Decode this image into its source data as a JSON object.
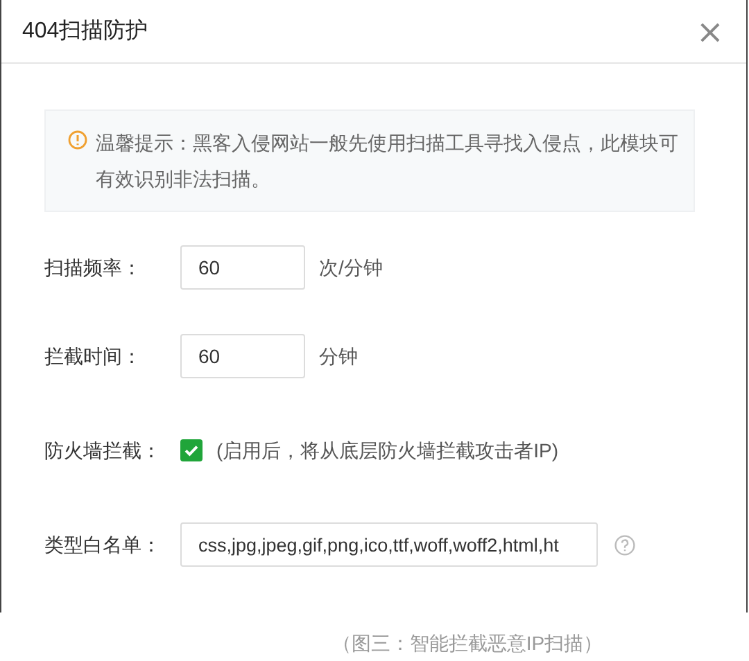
{
  "dialog": {
    "title": "404扫描防护",
    "close": "×"
  },
  "tip": "温馨提示：黑客入侵网站一般先使用扫描工具寻找入侵点，此模块可有效识别非法扫描。",
  "fields": [
    {
      "kind": "input",
      "label": "扫描频率：",
      "value": "60",
      "unit": "次/分钟"
    },
    {
      "kind": "input",
      "label": "拦截时间：",
      "value": "60",
      "unit": "分钟"
    },
    {
      "kind": "checkbox",
      "label": "防火墙拦截：",
      "checked": true,
      "note": "(启用后，将从底层防火墙拦截攻击者IP)"
    },
    {
      "kind": "wide_input",
      "label": "类型白名单：",
      "value": "css,jpg,jpeg,gif,png,ico,ttf,woff,woff2,html,ht",
      "help": true
    }
  ],
  "caption": "（图三：智能拦截恶意IP扫描）"
}
